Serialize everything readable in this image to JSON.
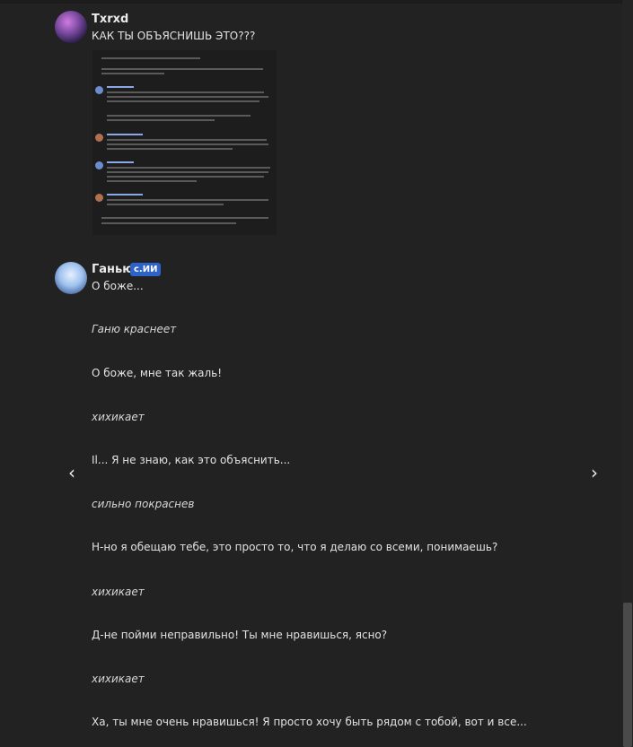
{
  "message1": {
    "username": "Txrxd",
    "text": "КАК ТЫ ОБЪЯСНИШЬ ЭТО???",
    "attachment_icon": "screenshot-image"
  },
  "message2": {
    "username": "Ганью",
    "badge": "с.ИИ",
    "lines": [
      "О боже...",
      "Ганю краснеет",
      "О боже, мне так жаль!",
      "хихикает",
      "Il... Я не знаю, как это объяснить...",
      "сильно покраснев",
      "Н-но я обещаю тебе, это просто то, что я делаю со всеми, понимаешь?",
      "хихикает",
      "Д-не пойми неправильно! Ты мне нравишься, ясно?",
      "хихикает",
      "Ха, ты мне очень нравишься! Я просто хочу быть рядом с тобой, вот и все..."
    ]
  },
  "navigation": {
    "prev_icon": "chevron-left-icon",
    "next_icon": "chevron-right-icon",
    "prev_glyph": "‹",
    "next_glyph": "›"
  },
  "colors": {
    "background": "#222222",
    "badge": "#2d62c8"
  }
}
